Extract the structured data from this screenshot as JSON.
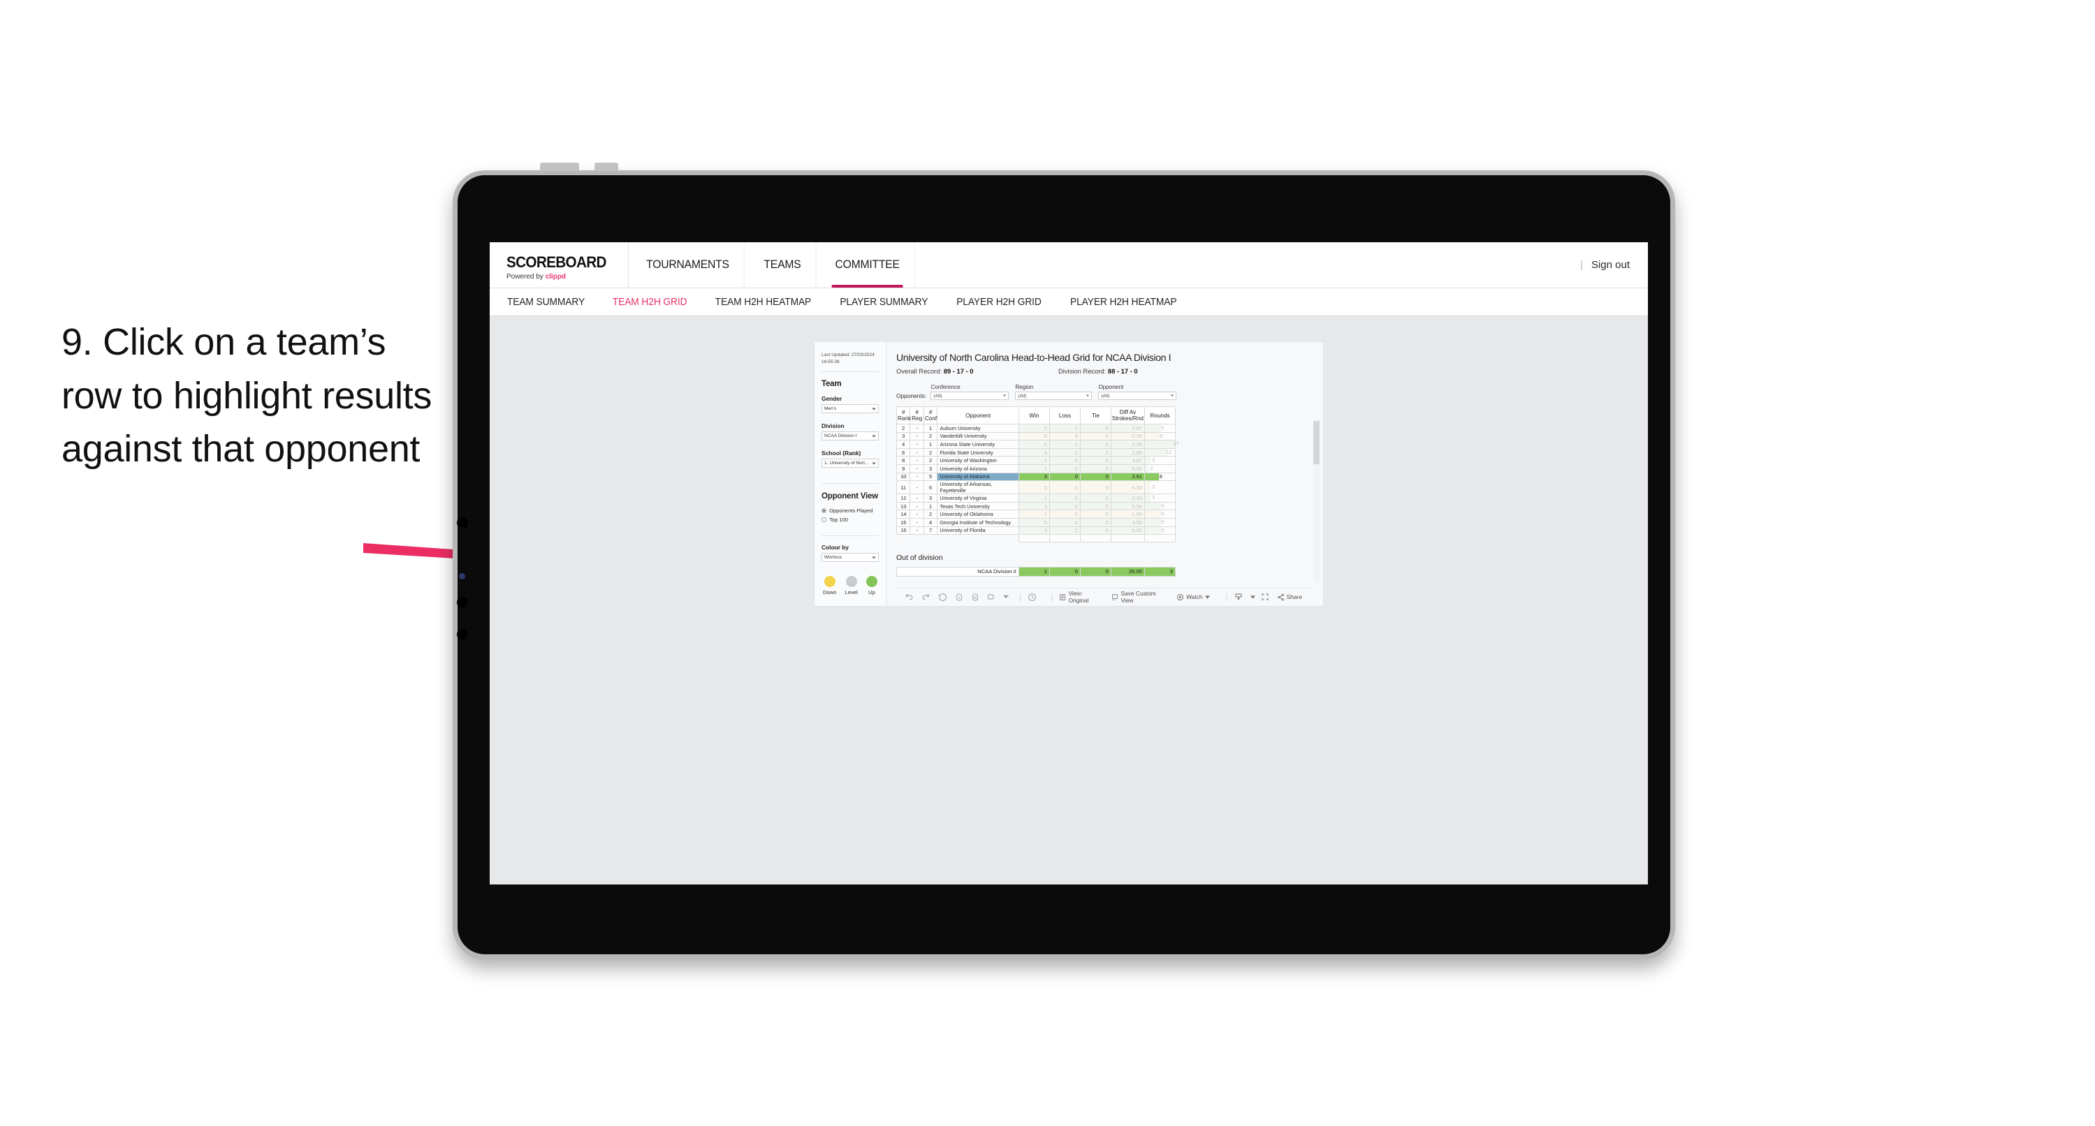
{
  "instruction": {
    "text": "9. Click on a team’s row to highlight results against that opponent",
    "arrow_color": "#EC2D63"
  },
  "app": {
    "brand": {
      "title": "SCOREBOARD",
      "powered_prefix": "Powered by ",
      "powered_name": "clippd"
    },
    "top_nav": [
      {
        "label": "TOURNAMENTS",
        "active": false
      },
      {
        "label": "TEAMS",
        "active": false
      },
      {
        "label": "COMMITTEE",
        "active": true
      }
    ],
    "header_right": {
      "divider": "|",
      "sign_out": "Sign out"
    },
    "sub_nav": [
      {
        "label": "TEAM SUMMARY",
        "active": false
      },
      {
        "label": "TEAM H2H GRID",
        "active": true
      },
      {
        "label": "TEAM H2H HEATMAP",
        "active": false
      },
      {
        "label": "PLAYER SUMMARY",
        "active": false
      },
      {
        "label": "PLAYER H2H GRID",
        "active": false
      },
      {
        "label": "PLAYER H2H HEATMAP",
        "active": false
      }
    ]
  },
  "panel": {
    "last_updated": "Last Updated: 27/03/2024 16:55:38",
    "team_heading": "Team",
    "gender_label": "Gender",
    "gender_value": "Men’s",
    "division_label": "Division",
    "division_value": "NCAA Division I",
    "school_label": "School (Rank)",
    "school_value": "1. University of Nort...",
    "opponent_view_heading": "Opponent View",
    "opponent_view_options": [
      {
        "label": "Opponents Played",
        "selected": true
      },
      {
        "label": "Top 100",
        "selected": false
      }
    ],
    "colour_by_label": "Colour by",
    "colour_by_value": "Win/loss",
    "legend": [
      {
        "label": "Down",
        "color": "#F2D34A"
      },
      {
        "label": "Level",
        "color": "#C9CCCF"
      },
      {
        "label": "Up",
        "color": "#84C55A"
      }
    ]
  },
  "viz": {
    "title": "University of North Carolina Head-to-Head Grid for NCAA Division I",
    "overall_record_label": "Overall Record:",
    "overall_record_value": "89 - 17 - 0",
    "division_record_label": "Division Record:",
    "division_record_value": "88 - 17 - 0",
    "opponents_label": "Opponents:",
    "filters": [
      {
        "label": "Conference",
        "value": "(All)"
      },
      {
        "label": "Region",
        "value": "(All)"
      },
      {
        "label": "Opponent",
        "value": "(All)"
      }
    ],
    "out_of_division_title": "Out of division"
  },
  "chart_data": {
    "type": "table",
    "title": "University of North Carolina Head-to-Head Grid for NCAA Division I",
    "columns": [
      "# Rank",
      "# Reg",
      "# Conf",
      "Opponent",
      "Win",
      "Loss",
      "Tie",
      "Diff Av Strokes/Rnd",
      "Rounds"
    ],
    "column_header_lines": [
      [
        "#",
        "Rank"
      ],
      [
        "#",
        "Reg"
      ],
      [
        "#",
        "Conf"
      ],
      [
        "",
        "Opponent"
      ],
      [
        "Win",
        ""
      ],
      [
        "Loss",
        ""
      ],
      [
        "Tie",
        ""
      ],
      [
        "Diff Av",
        "Strokes/Rnd"
      ],
      [
        "Rounds",
        ""
      ]
    ],
    "rounds_max": 17,
    "rows": [
      {
        "rank": "2",
        "reg": "-",
        "conf": "1",
        "opponent": "Auburn University",
        "win": "2",
        "loss": "1",
        "tie": "0",
        "diff": "1.67",
        "rounds": 9,
        "result": "up",
        "selected": false
      },
      {
        "rank": "3",
        "reg": "-",
        "conf": "2",
        "opponent": "Vanderbilt University",
        "win": "0",
        "loss": "4",
        "tie": "0",
        "diff": "-2.29",
        "rounds": 8,
        "result": "down",
        "selected": false
      },
      {
        "rank": "4",
        "reg": "-",
        "conf": "1",
        "opponent": "Arizona State University",
        "win": "5",
        "loss": "1",
        "tie": "0",
        "diff": "2.28",
        "rounds": 17,
        "result": "up",
        "selected": false
      },
      {
        "rank": "6",
        "reg": "-",
        "conf": "2",
        "opponent": "Florida State University",
        "win": "4",
        "loss": "2",
        "tie": "0",
        "diff": "1.83",
        "rounds": 12,
        "result": "up",
        "selected": false
      },
      {
        "rank": "8",
        "reg": "-",
        "conf": "2",
        "opponent": "University of Washington",
        "win": "1",
        "loss": "0",
        "tie": "0",
        "diff": "3.67",
        "rounds": 3,
        "result": "up",
        "selected": false
      },
      {
        "rank": "9",
        "reg": "-",
        "conf": "3",
        "opponent": "University of Arizona",
        "win": "1",
        "loss": "0",
        "tie": "0",
        "diff": "9.00",
        "rounds": 2,
        "result": "up",
        "selected": false
      },
      {
        "rank": "10",
        "reg": "-",
        "conf": "5",
        "opponent": "University of Alabama",
        "win": "3",
        "loss": "0",
        "tie": "0",
        "diff": "2.61",
        "rounds": 8,
        "result": "up",
        "selected": true
      },
      {
        "rank": "11",
        "reg": "-",
        "conf": "6",
        "opponent": "University of Arkansas, Fayetteville",
        "win": "0",
        "loss": "1",
        "tie": "0",
        "diff": "-4.33",
        "rounds": 3,
        "result": "down",
        "selected": false
      },
      {
        "rank": "12",
        "reg": "-",
        "conf": "3",
        "opponent": "University of Virginia",
        "win": "1",
        "loss": "0",
        "tie": "0",
        "diff": "2.33",
        "rounds": 3,
        "result": "up",
        "selected": false
      },
      {
        "rank": "13",
        "reg": "-",
        "conf": "1",
        "opponent": "Texas Tech University",
        "win": "3",
        "loss": "0",
        "tie": "0",
        "diff": "5.56",
        "rounds": 9,
        "result": "up",
        "selected": false
      },
      {
        "rank": "14",
        "reg": "-",
        "conf": "2",
        "opponent": "University of Oklahoma",
        "win": "1",
        "loss": "2",
        "tie": "0",
        "diff": "-1.00",
        "rounds": 9,
        "result": "down",
        "selected": false
      },
      {
        "rank": "15",
        "reg": "-",
        "conf": "4",
        "opponent": "Georgia Institute of Technology",
        "win": "5",
        "loss": "0",
        "tie": "0",
        "diff": "4.50",
        "rounds": 9,
        "result": "up",
        "selected": false
      },
      {
        "rank": "16",
        "reg": "-",
        "conf": "7",
        "opponent": "University of Florida",
        "win": "3",
        "loss": "1",
        "tie": "0",
        "diff": "6.62",
        "rounds": 9,
        "result": "up",
        "selected": false
      }
    ],
    "out_of_division": {
      "label": "NCAA Division II",
      "win": "1",
      "loss": "0",
      "tie": "0",
      "diff": "26.00",
      "rounds": "3"
    },
    "colors": {
      "up_fill": "#DCE9D4",
      "down_fill": "#F5EAD1",
      "selected_fill": "#8ACB61",
      "selected_opponent": "#7EAAC7"
    }
  },
  "toolbar": {
    "view_label": "View: Original",
    "save_custom_view": "Save Custom View",
    "watch": "Watch",
    "share": "Share"
  }
}
